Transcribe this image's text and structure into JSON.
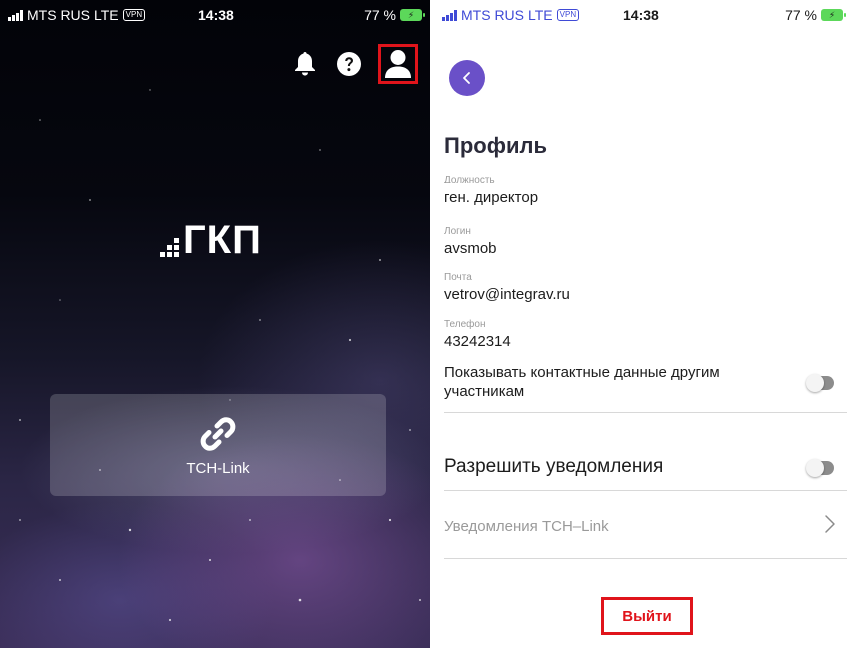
{
  "left_screen": {
    "status": {
      "carrier": "MTS RUS",
      "network": "LTE",
      "vpn": "VPN",
      "time": "14:38",
      "battery": "77 %"
    },
    "logo_text": "ГКП",
    "icons": [
      "bell-icon",
      "help-icon",
      "profile-icon"
    ],
    "tch_card": {
      "label": "TCH-Link",
      "icon": "link-icon"
    }
  },
  "right_screen": {
    "status": {
      "carrier": "MTS RUS",
      "network": "LTE",
      "vpn": "VPN",
      "time": "14:38",
      "battery": "77 %"
    },
    "title": "Профиль",
    "partial_label": "Должность",
    "position_value": "ген. директор",
    "fields": [
      {
        "label": "Логин",
        "value": "avsmob"
      },
      {
        "label": "Почта",
        "value": "vetrov@integrav.ru"
      },
      {
        "label": "Телефон",
        "value": "43242314"
      }
    ],
    "show_contacts": {
      "label": "Показывать контактные данные другим участникам",
      "enabled": false
    },
    "allow_notifications": {
      "label": "Разрешить уведомления",
      "enabled": false
    },
    "tch_notifications_label": "Уведомления TCH–Link",
    "logout_label": "Выйти"
  },
  "colors": {
    "accent_purple": "#6a50c8",
    "highlight_red": "#e0141b",
    "battery_green": "#5cd85a"
  }
}
